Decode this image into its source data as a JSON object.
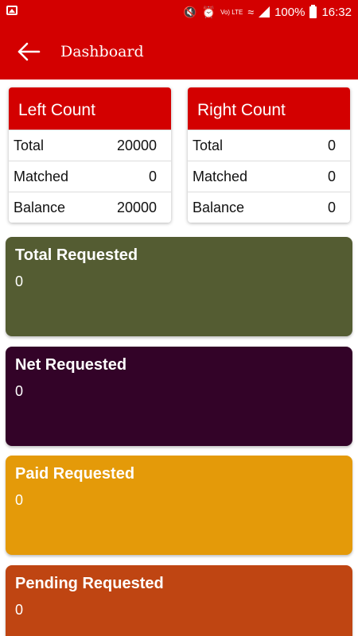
{
  "status_bar": {
    "battery_percent": "100%",
    "time": "16:32",
    "network_label": "Vo) LTE",
    "icons": [
      "gallery-icon",
      "mute-icon",
      "alarm-icon",
      "wifi-icon",
      "signal-icon",
      "battery-icon"
    ]
  },
  "app_bar": {
    "title": "Dashboard",
    "background": "#d30000"
  },
  "left_count": {
    "title": "Left Count",
    "rows": [
      {
        "label": "Total",
        "value": "20000"
      },
      {
        "label": "Matched",
        "value": "0"
      },
      {
        "label": "Balance",
        "value": "20000"
      }
    ]
  },
  "right_count": {
    "title": "Right Count",
    "rows": [
      {
        "label": "Total",
        "value": "0"
      },
      {
        "label": "Matched",
        "value": "0"
      },
      {
        "label": "Balance",
        "value": "0"
      }
    ]
  },
  "requests": [
    {
      "label": "Total Requested",
      "value": "0",
      "color": "#545c32"
    },
    {
      "label": "Net Requested",
      "value": "0",
      "color": "#330328"
    },
    {
      "label": "Paid Requested",
      "value": "0",
      "color": "#e49a09"
    },
    {
      "label": "Pending Requested",
      "value": "0",
      "color": "#bf4512"
    }
  ]
}
